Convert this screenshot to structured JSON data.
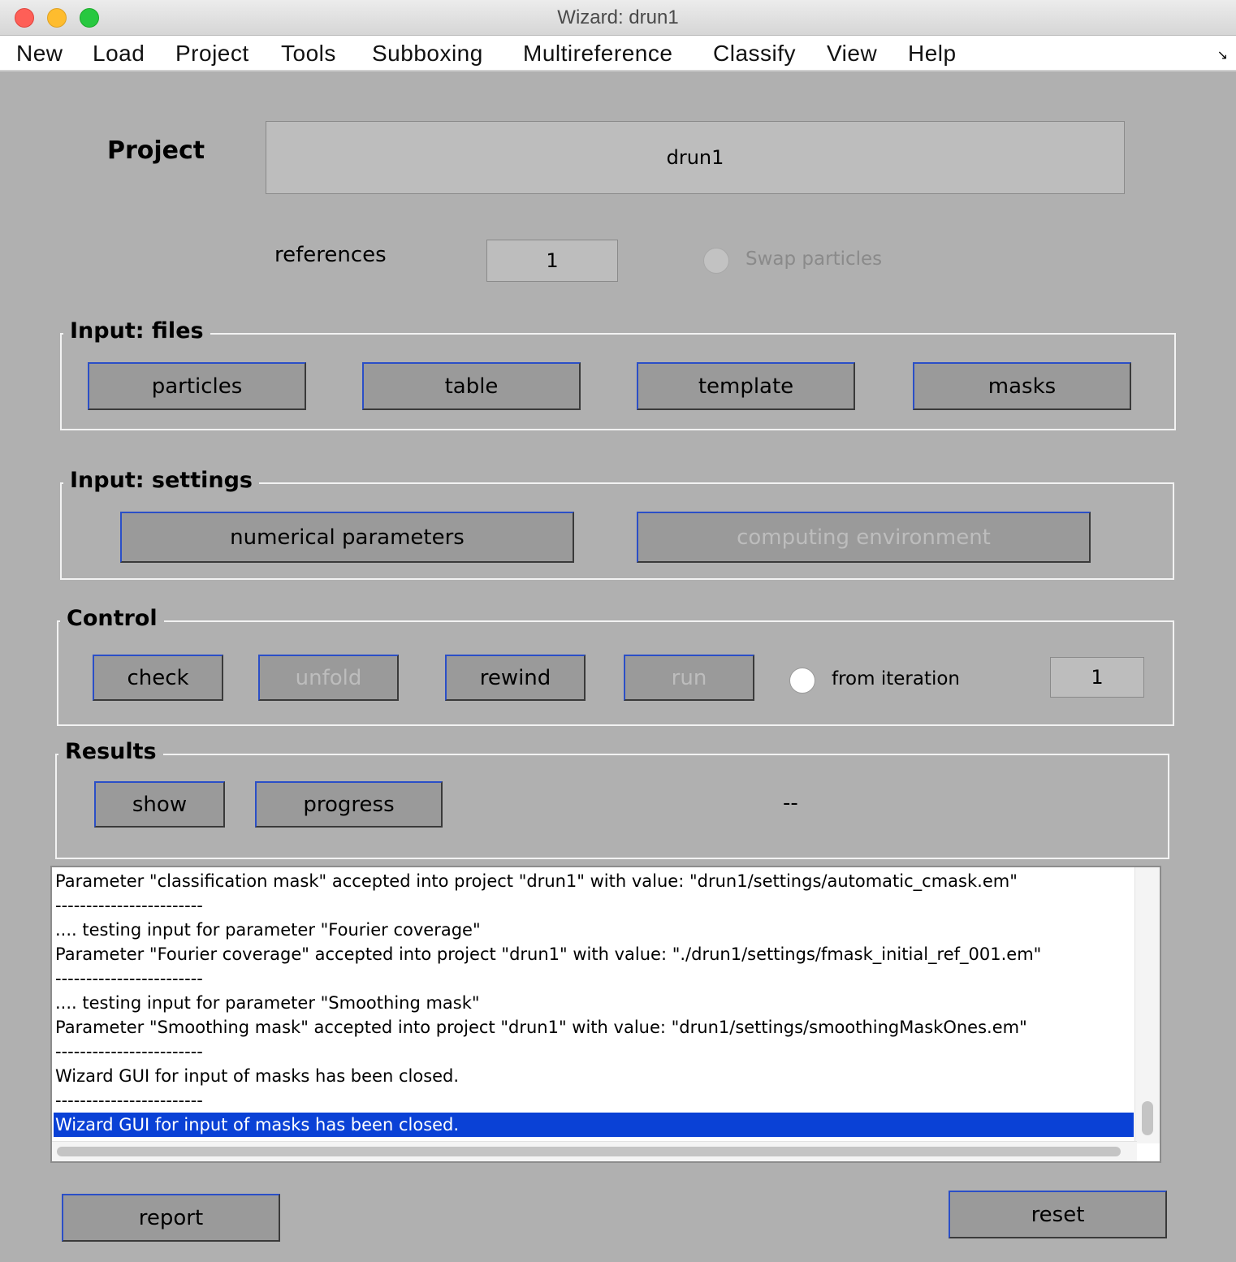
{
  "window": {
    "title": "Wizard: drun1",
    "controls": {
      "close_color": "#fe5f57",
      "minimize_color": "#febc2e",
      "zoom_color": "#28c840"
    }
  },
  "menubar": {
    "items": [
      "New",
      "Load",
      "Project",
      "Tools",
      "Subboxing",
      "Multireference",
      "Classify",
      "View",
      "Help"
    ],
    "corner_icon": "↘"
  },
  "project": {
    "label": "Project",
    "value": "drun1"
  },
  "references": {
    "label": "references",
    "value": "1",
    "swap_label": "Swap particles",
    "swap_enabled": false
  },
  "input_files": {
    "title": "Input: files",
    "buttons": [
      "particles",
      "table",
      "template",
      "masks"
    ]
  },
  "input_settings": {
    "title": "Input: settings",
    "numerical_label": "numerical parameters",
    "computing_label": "computing environment"
  },
  "control": {
    "title": "Control",
    "check_label": "check",
    "unfold_label": "unfold",
    "rewind_label": "rewind",
    "run_label": "run",
    "from_iteration_label": "from iteration",
    "iteration_value": "1"
  },
  "results": {
    "title": "Results",
    "show_label": "show",
    "progress_label": "progress",
    "status": "--"
  },
  "log": {
    "lines": [
      "Parameter \"classification mask\" accepted into project \"drun1\" with value: \"drun1/settings/automatic_cmask.em\"",
      "------------------------",
      ".... testing input for parameter \"Fourier coverage\"",
      "Parameter \"Fourier coverage\" accepted into project \"drun1\" with value: \"./drun1/settings/fmask_initial_ref_001.em\"",
      "------------------------",
      ".... testing input for parameter \"Smoothing mask\"",
      "Parameter \"Smoothing mask\" accepted into project \"drun1\" with value: \"drun1/settings/smoothingMaskOnes.em\"",
      "------------------------",
      "Wizard GUI for input of masks has been closed.",
      "------------------------",
      "Wizard GUI for input of masks has been closed."
    ],
    "selected_color": "#0a41d6"
  },
  "footer": {
    "report_label": "report",
    "reset_label": "reset"
  }
}
